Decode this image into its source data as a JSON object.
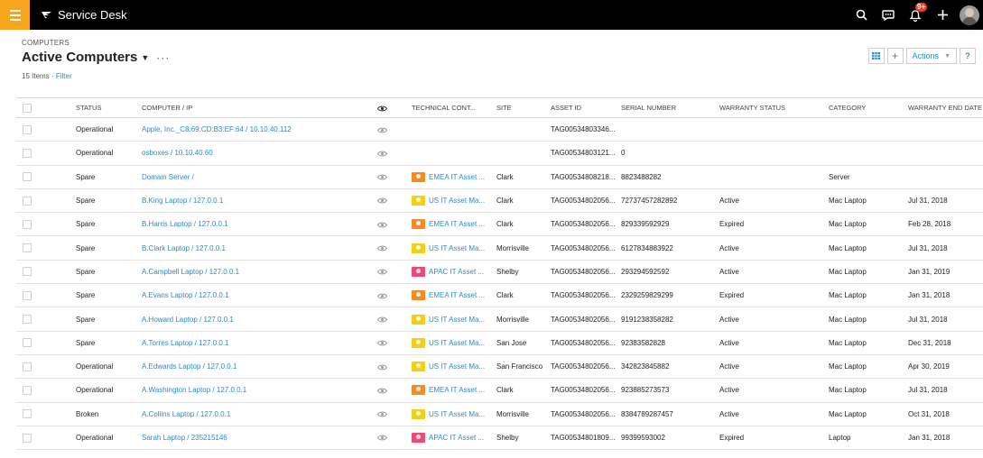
{
  "app": {
    "title": "Service Desk",
    "notification_count": "9+"
  },
  "colors": {
    "accent": "#f7a51d",
    "link": "#2b8cc4",
    "topbar": "#000000"
  },
  "icons": [
    "menu-icon",
    "brand-logo-icon",
    "search-icon",
    "chat-icon",
    "notification-bell-icon",
    "plus-icon",
    "user-avatar",
    "eye-icon",
    "grid-icon",
    "help-icon"
  ],
  "header": {
    "breadcrumb": "COMPUTERS",
    "title": "Active Computers",
    "item_count": "15 Items",
    "separator": "·",
    "filter_label": "Filter"
  },
  "actions": {
    "add_label": "+",
    "actions_label": "Actions",
    "help_label": "?"
  },
  "table": {
    "columns": [
      "STATUS",
      "COMPUTER / IP",
      "TECHNICAL CONT...",
      "SITE",
      "ASSET ID",
      "SERIAL NUMBER",
      "WARRANTY STATUS",
      "CATEGORY",
      "WARRANTY END DATE"
    ],
    "rows": [
      {
        "status": "Operational",
        "computer": "Apple, Inc._C8:69:CD:B3:EF:64 / 10.10.40.112",
        "tech_contact": "",
        "tech_color": "",
        "site": "",
        "asset_id": "TAG00534803346...",
        "serial": "",
        "warranty_status": "",
        "category": "",
        "warranty_end": ""
      },
      {
        "status": "Operational",
        "computer": "osboxes / 10.10.40.60",
        "tech_contact": "",
        "tech_color": "",
        "site": "",
        "asset_id": "TAG00534803121...",
        "serial": "0",
        "warranty_status": "",
        "category": "",
        "warranty_end": ""
      },
      {
        "status": "Spare",
        "computer": "Domain Server /",
        "tech_contact": "EMEA IT Asset ...",
        "tech_color": "orange",
        "site": "Clark",
        "asset_id": "TAG00534808218...",
        "serial": "8823488282",
        "warranty_status": "",
        "category": "Server",
        "warranty_end": ""
      },
      {
        "status": "Spare",
        "computer": "B.King Laptop / 127.0.0.1",
        "tech_contact": "US IT Asset Ma...",
        "tech_color": "yellow",
        "site": "Clark",
        "asset_id": "TAG00534802056...",
        "serial": "72737457282892",
        "warranty_status": "Active",
        "category": "Mac Laptop",
        "warranty_end": "Jul 31, 2018"
      },
      {
        "status": "Spare",
        "computer": "B.Harris Laptop / 127.0.0.1",
        "tech_contact": "EMEA IT Asset ...",
        "tech_color": "orange",
        "site": "Clark",
        "asset_id": "TAG00534802056...",
        "serial": "829339592929",
        "warranty_status": "Expired",
        "category": "Mac Laptop",
        "warranty_end": "Feb 28, 2018"
      },
      {
        "status": "Spare",
        "computer": "B.Clark Laptop / 127.0.0.1",
        "tech_contact": "US IT Asset Ma...",
        "tech_color": "yellow",
        "site": "Morrisville",
        "asset_id": "TAG00534802056...",
        "serial": "6127834883922",
        "warranty_status": "Active",
        "category": "Mac Laptop",
        "warranty_end": "Jul 31, 2018"
      },
      {
        "status": "Spare",
        "computer": "A.Campbell Laptop / 127.0.0.1",
        "tech_contact": "APAC IT Asset ...",
        "tech_color": "pink",
        "site": "Shelby",
        "asset_id": "TAG00534802056...",
        "serial": "293294592592",
        "warranty_status": "Active",
        "category": "Mac Laptop",
        "warranty_end": "Jan 31, 2019"
      },
      {
        "status": "Spare",
        "computer": "A.Evans Laptop / 127.0.0.1",
        "tech_contact": "EMEA IT Asset ...",
        "tech_color": "orange",
        "site": "Clark",
        "asset_id": "TAG00534802056...",
        "serial": "2329259829299",
        "warranty_status": "Expired",
        "category": "Mac Laptop",
        "warranty_end": "Jan 31, 2018"
      },
      {
        "status": "Spare",
        "computer": "A.Howard Laptop / 127.0.0.1",
        "tech_contact": "US IT Asset Ma...",
        "tech_color": "yellow",
        "site": "Morrisville",
        "asset_id": "TAG00534802056...",
        "serial": "9191238358282",
        "warranty_status": "Active",
        "category": "Mac Laptop",
        "warranty_end": "Jul 31, 2018"
      },
      {
        "status": "Spare",
        "computer": "A.Torres Laptop / 127.0.0.1",
        "tech_contact": "US IT Asset Ma...",
        "tech_color": "yellow",
        "site": "San Jose",
        "asset_id": "TAG00534802056...",
        "serial": "92383582828",
        "warranty_status": "Active",
        "category": "Mac Laptop",
        "warranty_end": "Dec 31, 2018"
      },
      {
        "status": "Operational",
        "computer": "A.Edwards Laptop / 127.0.0.1",
        "tech_contact": "US IT Asset Ma...",
        "tech_color": "yellow",
        "site": "San Francisco",
        "asset_id": "TAG00534802056...",
        "serial": "342823845882",
        "warranty_status": "Active",
        "category": "Mac Laptop",
        "warranty_end": "Apr 30, 2019"
      },
      {
        "status": "Operational",
        "computer": "A.Washington Laptop / 127.0.0.1",
        "tech_contact": "EMEA IT Asset ...",
        "tech_color": "orange",
        "site": "Clark",
        "asset_id": "TAG00534802056...",
        "serial": "923885273573",
        "warranty_status": "Active",
        "category": "Mac Laptop",
        "warranty_end": "Jul 31, 2018"
      },
      {
        "status": "Broken",
        "computer": "A.Collins Laptop / 127.0.0.1",
        "tech_contact": "US IT Asset Ma...",
        "tech_color": "yellow",
        "site": "Morrisville",
        "asset_id": "TAG00534802056...",
        "serial": "83847892874​57",
        "warranty_status": "Active",
        "category": "Mac Laptop",
        "warranty_end": "Oct 31, 2018"
      },
      {
        "status": "Operational",
        "computer": "Sarah Laptop / 235215146",
        "tech_contact": "APAC IT Asset ...",
        "tech_color": "pink",
        "site": "Shelby",
        "asset_id": "TAG00534801809...",
        "serial": "99399593002",
        "warranty_status": "Expired",
        "category": "Laptop",
        "warranty_end": "Jan 31, 2018"
      }
    ]
  }
}
